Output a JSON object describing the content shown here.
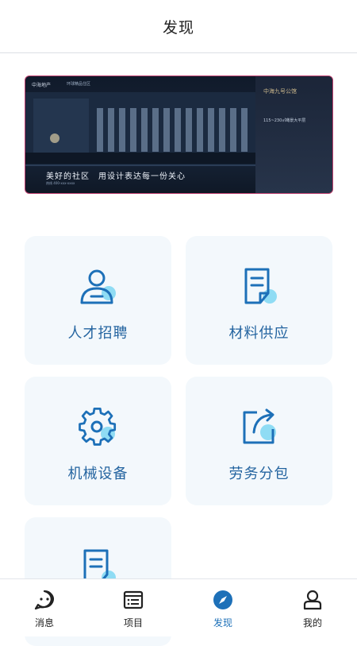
{
  "header": {
    "title": "发现"
  },
  "banner": {
    "brand": "中海地产",
    "brand_sub": "环球精品住区",
    "project_name": "中海九号公馆",
    "area": "115~230㎡瞰景大平层",
    "slogan": "美好的社区　用设计表达每一份关心",
    "fine_print": "热线 400-xxx-xxxx"
  },
  "cards": [
    {
      "label": "人才招聘",
      "icon": "person-icon"
    },
    {
      "label": "材料供应",
      "icon": "document-icon"
    },
    {
      "label": "机械设备",
      "icon": "gear-icon"
    },
    {
      "label": "劳务分包",
      "icon": "share-arrow-icon"
    },
    {
      "label": "",
      "icon": "document-icon"
    }
  ],
  "tabs": [
    {
      "label": "消息",
      "icon": "message-icon",
      "active": false
    },
    {
      "label": "项目",
      "icon": "list-icon",
      "active": false
    },
    {
      "label": "发现",
      "icon": "compass-icon",
      "active": true
    },
    {
      "label": "我的",
      "icon": "user-icon",
      "active": false
    }
  ],
  "colors": {
    "accent": "#1d70b8",
    "card_bg": "#f3f8fc",
    "icon_fill": "#8fdcf4"
  }
}
